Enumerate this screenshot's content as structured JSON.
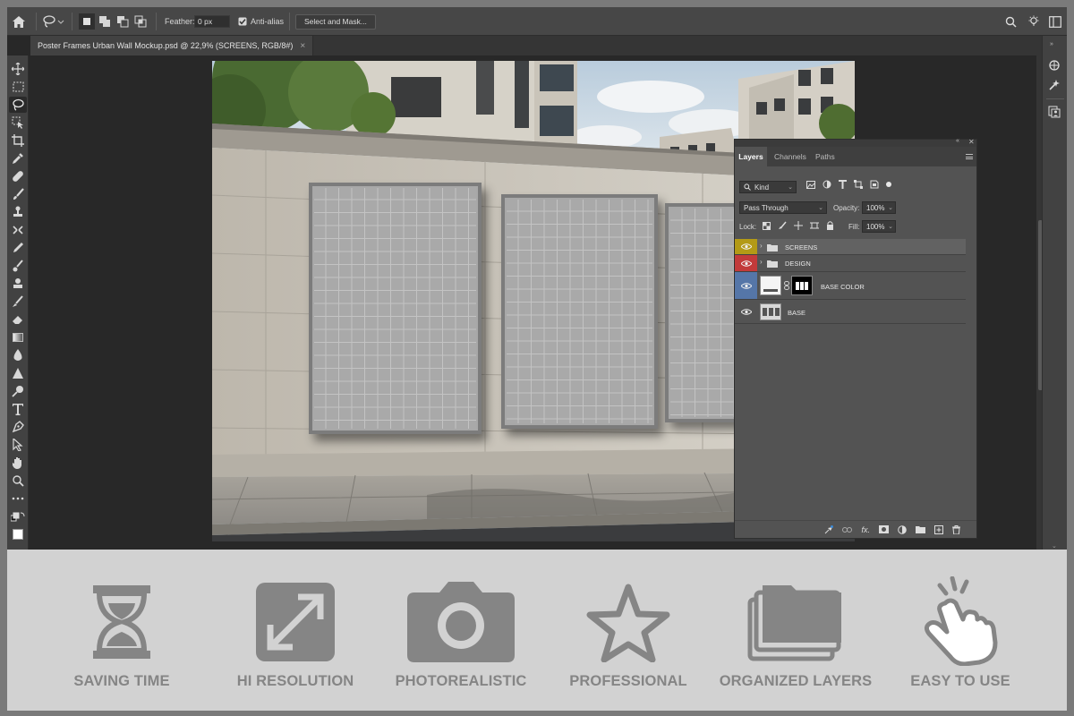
{
  "options_bar": {
    "feather_label": "Feather:",
    "feather_value": "0 px",
    "antialias_label": "Anti-alias",
    "antialias_checked": true,
    "select_mask_label": "Select and Mask..."
  },
  "document_tab": {
    "title": "Poster Frames Urban Wall Mockup.psd @ 22,9% (SCREENS, RGB/8#)",
    "close": "×"
  },
  "layers_panel": {
    "tabs": [
      "Layers",
      "Channels",
      "Paths"
    ],
    "filter_kind": "Kind",
    "blend_mode": "Pass Through",
    "opacity_label": "Opacity:",
    "opacity_value": "100%",
    "lock_label": "Lock:",
    "fill_label": "Fill:",
    "fill_value": "100%",
    "layers": [
      {
        "name": "SCREENS",
        "kind": "group",
        "eye_color": "#b39a16"
      },
      {
        "name": "DESIGN",
        "kind": "group",
        "eye_color": "#c23a3a"
      },
      {
        "name": "BASE COLOR",
        "kind": "adjustment",
        "eye_color": "#5576a8"
      },
      {
        "name": "BASE",
        "kind": "image",
        "eye_color": "#535353"
      }
    ]
  },
  "features": [
    {
      "label": "SAVING TIME",
      "icon": "hourglass-icon"
    },
    {
      "label": "HI RESOLUTION",
      "icon": "expand-icon"
    },
    {
      "label": "PHOTOREALISTIC",
      "icon": "camera-icon"
    },
    {
      "label": "PROFESSIONAL",
      "icon": "star-icon"
    },
    {
      "label": "ORGANIZED LAYERS",
      "icon": "layers-folder-icon"
    },
    {
      "label": "EASY TO USE",
      "icon": "tap-hand-icon"
    }
  ],
  "colors": {
    "feature_gray": "#858585",
    "panel_bg": "#535353",
    "app_bg": "#282828"
  }
}
